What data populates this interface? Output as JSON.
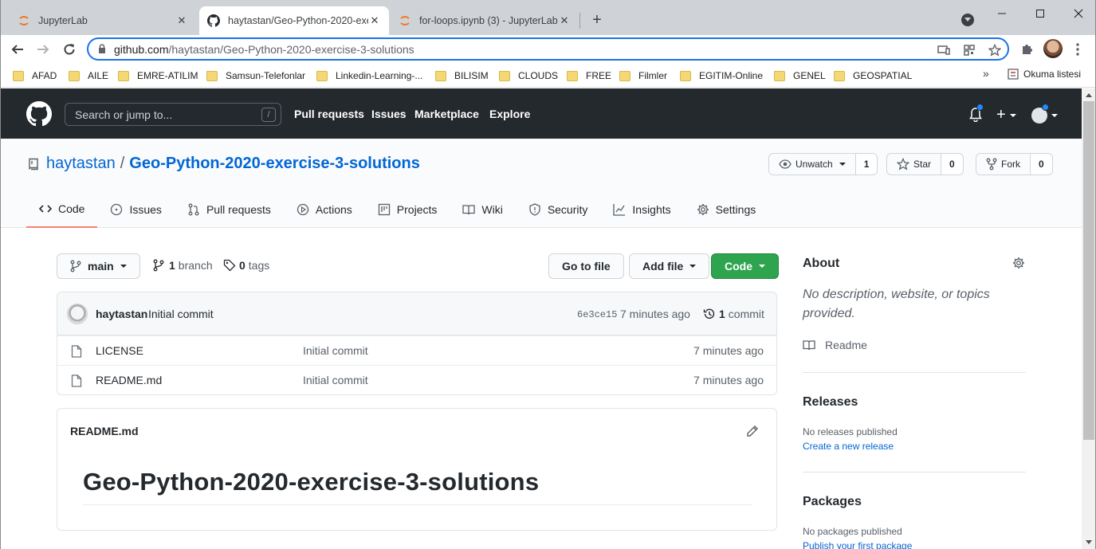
{
  "browser": {
    "tabs": [
      {
        "title": "JupyterLab",
        "icon": "jupyter-icon"
      },
      {
        "title": "haytastan/Geo-Python-2020-exe",
        "icon": "github-icon"
      },
      {
        "title": "for-loops.ipynb (3) - JupyterLab",
        "icon": "jupyter-icon"
      }
    ],
    "url_host": "github.com",
    "url_path": "/haytastan/Geo-Python-2020-exercise-3-solutions",
    "bookmarks": [
      "AFAD",
      "AILE",
      "EMRE-ATILIM",
      "Samsun-Telefonlar",
      "Linkedin-Learning-...",
      "BILISIM",
      "CLOUDS",
      "FREE",
      "Filmler",
      "EGITIM-Online",
      "GENEL",
      "GEOSPATIAL"
    ],
    "more_bookmarks": "»",
    "reading_list": "Okuma listesi",
    "colors": {
      "tabstrip": "#cfd3d7",
      "focus": "#1a73e8"
    }
  },
  "github": {
    "search_placeholder": "Search or jump to...",
    "search_shortcut": "/",
    "nav": [
      "Pull requests",
      "Issues",
      "Marketplace",
      "Explore"
    ],
    "repo_owner": "haytastan",
    "repo_sep": "/",
    "repo_name": "Geo-Python-2020-exercise-3-solutions",
    "watch": {
      "label": "Unwatch",
      "count": "1"
    },
    "star": {
      "label": "Star",
      "count": "0"
    },
    "fork": {
      "label": "Fork",
      "count": "0"
    },
    "tabs": [
      "Code",
      "Issues",
      "Pull requests",
      "Actions",
      "Projects",
      "Wiki",
      "Security",
      "Insights",
      "Settings"
    ],
    "branch": "main",
    "branches_count": "1",
    "branches_label": "branch",
    "tags_count": "0",
    "tags_label": "tags",
    "go_to_file": "Go to file",
    "add_file": "Add file",
    "code_button": "Code",
    "latest_commit": {
      "author": "haytastan",
      "message": "Initial commit",
      "sha": "6e3ce15",
      "time": "7 minutes ago",
      "commits_count": "1",
      "commits_label": "commit"
    },
    "files": [
      {
        "name": "LICENSE",
        "message": "Initial commit",
        "time": "7 minutes ago"
      },
      {
        "name": "README.md",
        "message": "Initial commit",
        "time": "7 minutes ago"
      }
    ],
    "readme": {
      "filename": "README.md",
      "heading": "Geo-Python-2020-exercise-3-solutions"
    },
    "about": {
      "title": "About",
      "description": "No description, website, or topics provided.",
      "readme_link": "Readme"
    },
    "releases": {
      "title": "Releases",
      "empty": "No releases published",
      "link": "Create a new release"
    },
    "packages": {
      "title": "Packages",
      "empty": "No packages published",
      "link": "Publish your first package"
    },
    "colors": {
      "header": "#24292e",
      "link": "#0366d6",
      "green": "#2ea44f",
      "tab_underline": "#f9826c"
    }
  }
}
